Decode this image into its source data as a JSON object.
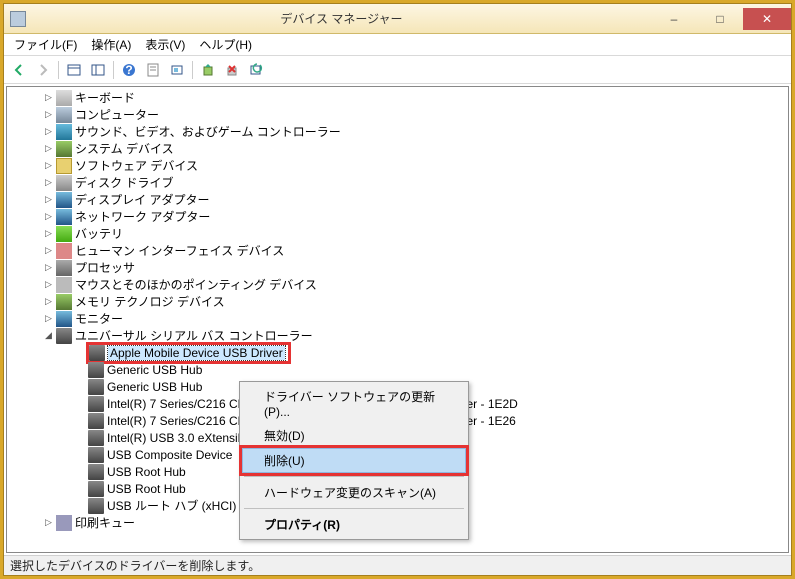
{
  "window": {
    "title": "デバイス マネージャー",
    "btn_min": "–",
    "btn_max": "□",
    "btn_close": "✕"
  },
  "menu": {
    "file": "ファイル(F)",
    "action": "操作(A)",
    "view": "表示(V)",
    "help": "ヘルプ(H)"
  },
  "toolbar": {
    "back": "←",
    "fwd": "→",
    "up": "▭",
    "tree": "▤",
    "help": "?",
    "props": "▭",
    "refresh": "▭",
    "upd": "▭",
    "del": "✖",
    "scan": "⟳"
  },
  "tree": {
    "nodes": [
      {
        "indent": 36,
        "exp": "▷",
        "icon": "ic-kb",
        "label": "キーボード"
      },
      {
        "indent": 36,
        "exp": "▷",
        "icon": "ic-pc",
        "label": "コンピューター"
      },
      {
        "indent": 36,
        "exp": "▷",
        "icon": "ic-snd",
        "label": "サウンド、ビデオ、およびゲーム コントローラー"
      },
      {
        "indent": 36,
        "exp": "▷",
        "icon": "ic-sys",
        "label": "システム デバイス"
      },
      {
        "indent": 36,
        "exp": "▷",
        "icon": "ic-sw",
        "label": "ソフトウェア デバイス"
      },
      {
        "indent": 36,
        "exp": "▷",
        "icon": "ic-disk",
        "label": "ディスク ドライブ"
      },
      {
        "indent": 36,
        "exp": "▷",
        "icon": "ic-disp",
        "label": "ディスプレイ アダプター"
      },
      {
        "indent": 36,
        "exp": "▷",
        "icon": "ic-net",
        "label": "ネットワーク アダプター"
      },
      {
        "indent": 36,
        "exp": "▷",
        "icon": "ic-bat",
        "label": "バッテリ"
      },
      {
        "indent": 36,
        "exp": "▷",
        "icon": "ic-hid",
        "label": "ヒューマン インターフェイス デバイス"
      },
      {
        "indent": 36,
        "exp": "▷",
        "icon": "ic-cpu",
        "label": "プロセッサ"
      },
      {
        "indent": 36,
        "exp": "▷",
        "icon": "ic-mouse",
        "label": "マウスとそのほかのポインティング デバイス"
      },
      {
        "indent": 36,
        "exp": "▷",
        "icon": "ic-mem",
        "label": "メモリ テクノロジ デバイス"
      },
      {
        "indent": 36,
        "exp": "▷",
        "icon": "ic-mon",
        "label": "モニター"
      },
      {
        "indent": 36,
        "exp": "◢",
        "icon": "ic-usb",
        "label": "ユニバーサル シリアル バス コントローラー"
      },
      {
        "indent": 68,
        "exp": "",
        "icon": "ic-usb",
        "label": "Apple Mobile Device USB Driver",
        "selected": true,
        "red": true
      },
      {
        "indent": 68,
        "exp": "",
        "icon": "ic-usb",
        "label": "Generic USB Hub"
      },
      {
        "indent": 68,
        "exp": "",
        "icon": "ic-usb",
        "label": "Generic USB Hub"
      },
      {
        "indent": 68,
        "exp": "",
        "icon": "ic-usb",
        "label": "Intel(R) 7 Series/C216 Chipset Family USB Enhanced Host Controller - 1E2D"
      },
      {
        "indent": 68,
        "exp": "",
        "icon": "ic-usb",
        "label": "Intel(R) 7 Series/C216 Chipset Family USB Enhanced Host Controller - 1E26"
      },
      {
        "indent": 68,
        "exp": "",
        "icon": "ic-usb",
        "label": "Intel(R) USB 3.0 eXtensible Host Controller"
      },
      {
        "indent": 68,
        "exp": "",
        "icon": "ic-usb",
        "label": "USB Composite Device"
      },
      {
        "indent": 68,
        "exp": "",
        "icon": "ic-usb",
        "label": "USB Root Hub"
      },
      {
        "indent": 68,
        "exp": "",
        "icon": "ic-usb",
        "label": "USB Root Hub"
      },
      {
        "indent": 68,
        "exp": "",
        "icon": "ic-usb",
        "label": "USB ルート ハブ (xHCI)"
      },
      {
        "indent": 36,
        "exp": "▷",
        "icon": "ic-prn",
        "label": "印刷キュー"
      }
    ]
  },
  "context": {
    "update": "ドライバー ソフトウェアの更新(P)...",
    "disable": "無効(D)",
    "delete": "削除(U)",
    "scan": "ハードウェア変更のスキャン(A)",
    "properties": "プロパティ(R)"
  },
  "statusbar": {
    "text": "選択したデバイスのドライバーを削除します。"
  }
}
